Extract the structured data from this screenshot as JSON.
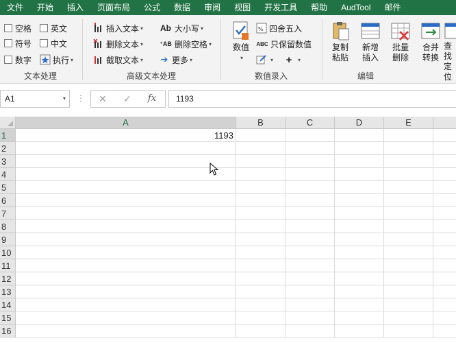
{
  "menu": {
    "tabs": [
      "文件",
      "开始",
      "插入",
      "页面布局",
      "公式",
      "数据",
      "审阅",
      "视图",
      "开发工具",
      "帮助",
      "AudTool",
      "邮件"
    ]
  },
  "ribbon": {
    "text_processing": {
      "label": "文本处理",
      "checkboxes": [
        "空格",
        "英文",
        "符号",
        "中文",
        "数字"
      ],
      "execute": "执行"
    },
    "advanced_text": {
      "label": "高级文本处理",
      "insert_text": "插入文本",
      "delete_text": "删除文本",
      "extract_text": "截取文本",
      "case": "大小写",
      "delete_space": "删除空格",
      "more": "更多"
    },
    "numeric_entry": {
      "label": "数值录入",
      "numeric": "数值",
      "round": "四舍五入",
      "keep_value": "只保留数值"
    },
    "edit": {
      "label": "编辑",
      "copy_paste": "复制粘贴",
      "add_insert": "新增插入",
      "batch_delete": "批量删除",
      "merge_convert": "合并转换",
      "find_locate": "查找定位"
    }
  },
  "formula_bar": {
    "name_box": "A1",
    "formula": "1193"
  },
  "grid": {
    "columns": [
      "A",
      "B",
      "C",
      "D",
      "E"
    ],
    "rows": [
      "1",
      "2",
      "3",
      "4",
      "5",
      "6",
      "7",
      "8",
      "9",
      "10",
      "11",
      "12",
      "13",
      "14",
      "15",
      "16"
    ],
    "cell_a1": "1193"
  },
  "colors": {
    "accent": "#217346"
  }
}
